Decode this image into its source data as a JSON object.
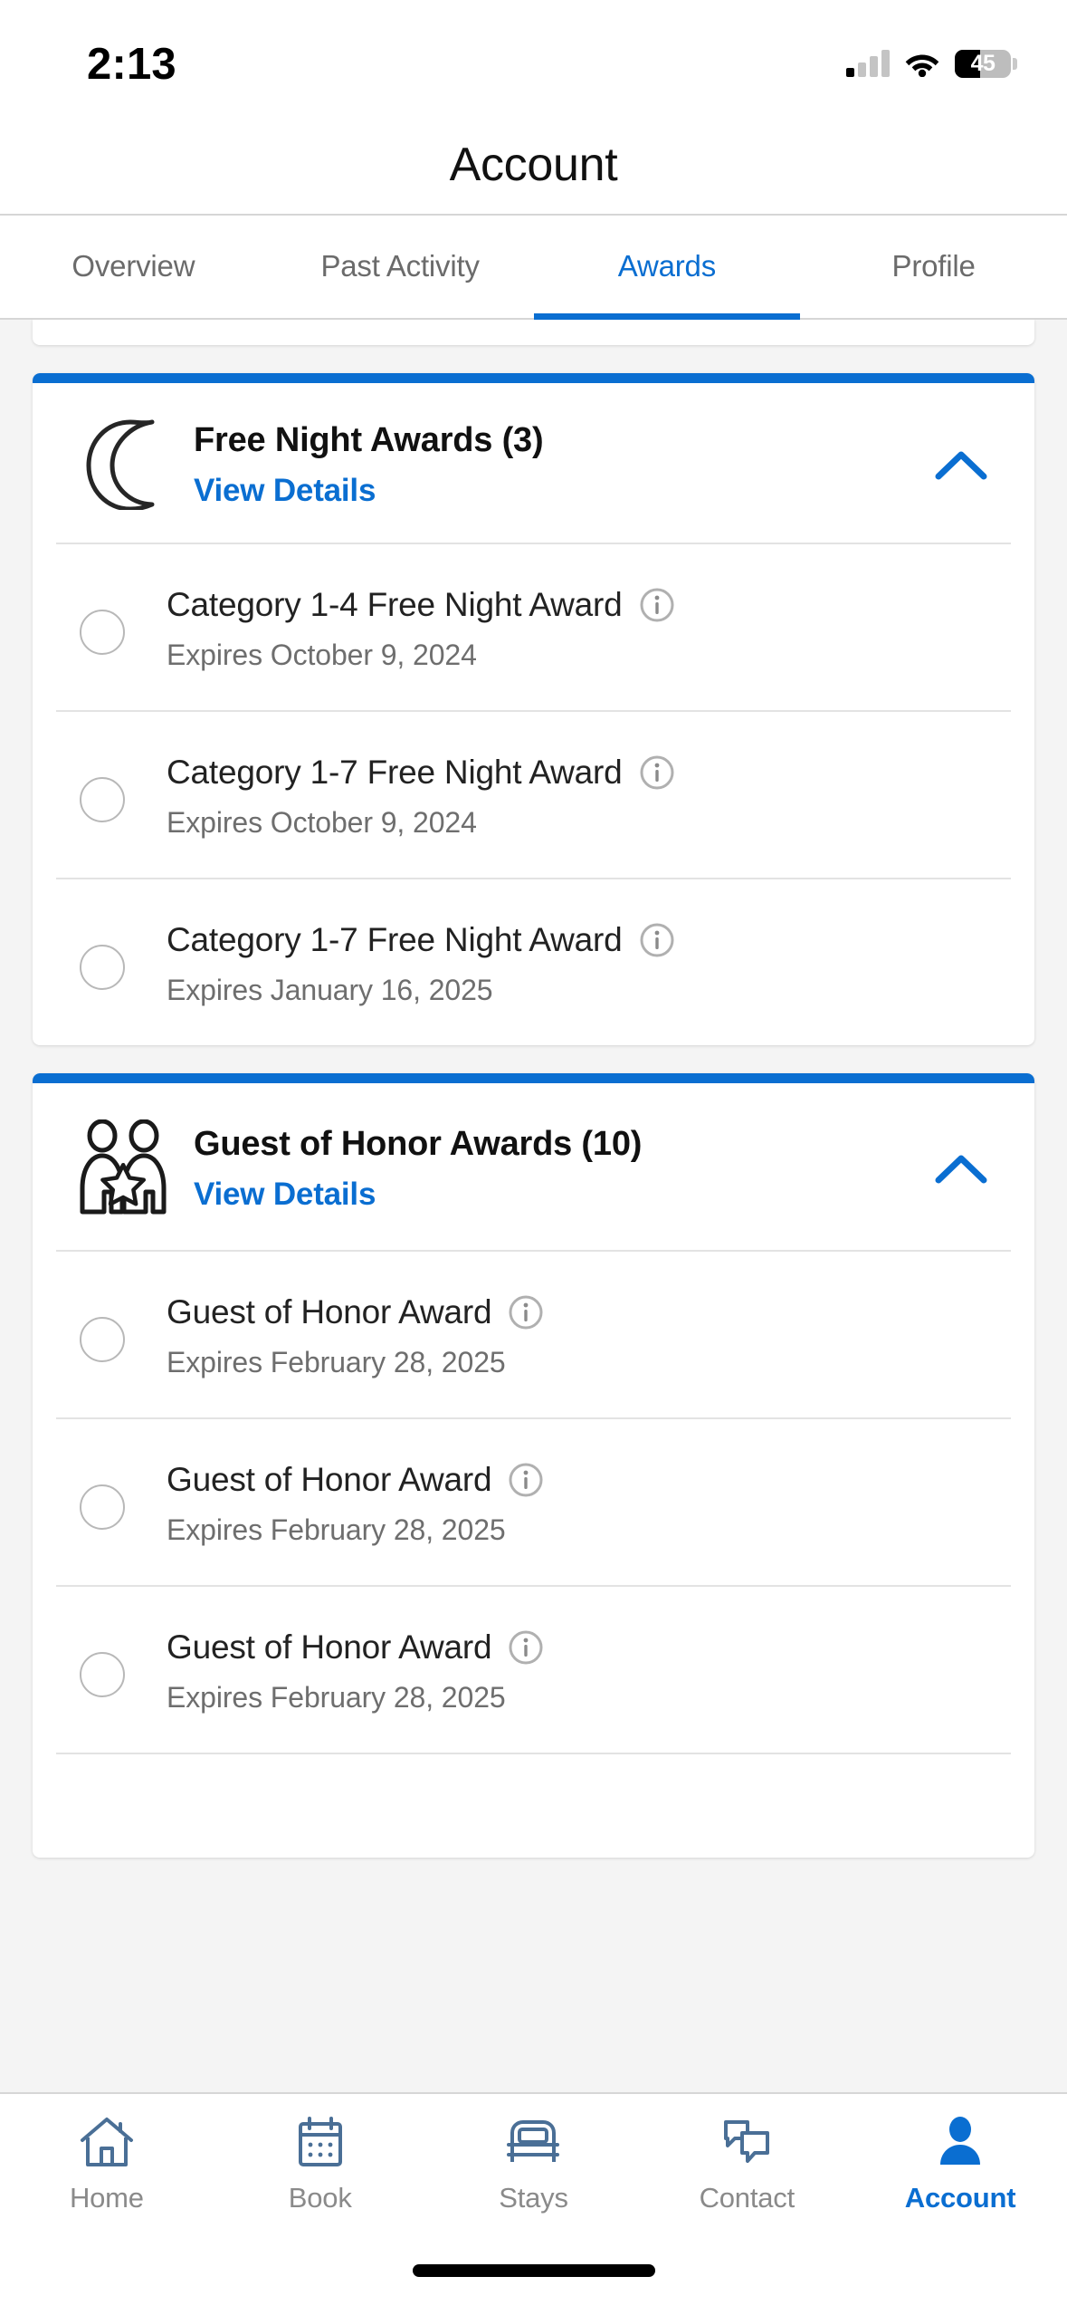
{
  "status_bar": {
    "time": "2:13",
    "battery_percent": "45",
    "battery_level": 45,
    "icons": [
      "cellular-signal-icon",
      "wifi-icon",
      "battery-icon"
    ]
  },
  "header": {
    "title": "Account"
  },
  "tabs": [
    {
      "label": "Overview",
      "active": false
    },
    {
      "label": "Past Activity",
      "active": false
    },
    {
      "label": "Awards",
      "active": true
    },
    {
      "label": "Profile",
      "active": false
    }
  ],
  "theme": {
    "accent": "#0a6ed1",
    "page_background": "#f4f4f4",
    "card_background": "#ffffff",
    "title_color": "#111111",
    "muted_text": "#6e6e6e"
  },
  "award_sections": [
    {
      "icon": "crescent-moon-icon",
      "title": "Free Night Awards (3)",
      "view_details_label": "View Details",
      "expanded": true,
      "chevron": "chevron-up-icon",
      "awards": [
        {
          "title": "Category 1-4 Free Night Award",
          "expiry": "Expires October 9, 2024",
          "selected": false
        },
        {
          "title": "Category 1-7 Free Night Award",
          "expiry": "Expires October 9, 2024",
          "selected": false
        },
        {
          "title": "Category 1-7 Free Night Award",
          "expiry": "Expires January 16, 2025",
          "selected": false
        }
      ]
    },
    {
      "icon": "guest-of-honor-icon",
      "title": "Guest of Honor Awards (10)",
      "view_details_label": "View Details",
      "expanded": true,
      "chevron": "chevron-up-icon",
      "awards": [
        {
          "title": "Guest of Honor Award",
          "expiry": "Expires February 28, 2025",
          "selected": false
        },
        {
          "title": "Guest of Honor Award",
          "expiry": "Expires February 28, 2025",
          "selected": false
        },
        {
          "title": "Guest of Honor Award",
          "expiry": "Expires February 28, 2025",
          "selected": false
        }
      ]
    }
  ],
  "bottom_nav": [
    {
      "label": "Home",
      "icon": "house-icon",
      "active": false
    },
    {
      "label": "Book",
      "icon": "calendar-icon",
      "active": false
    },
    {
      "label": "Stays",
      "icon": "bed-icon",
      "active": false
    },
    {
      "label": "Contact",
      "icon": "chat-bubbles-icon",
      "active": false
    },
    {
      "label": "Account",
      "icon": "person-icon",
      "active": true
    }
  ]
}
